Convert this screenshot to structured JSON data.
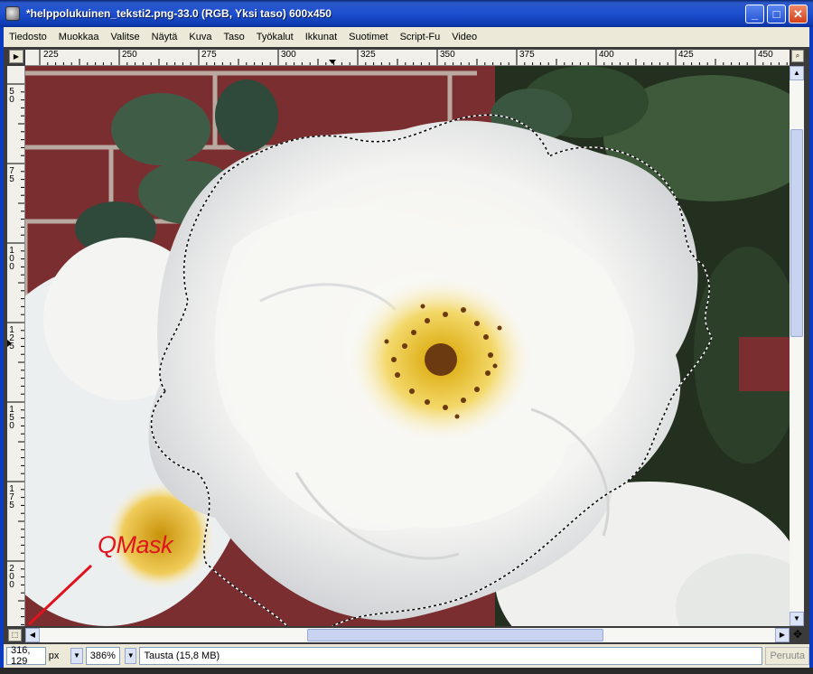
{
  "window": {
    "title": "*helppolukuinen_teksti2.png-33.0 (RGB, Yksi taso) 600x450",
    "minimize_glyph": "_",
    "maximize_glyph": "□",
    "close_glyph": "✕"
  },
  "menubar": {
    "items": [
      "Tiedosto",
      "Muokkaa",
      "Valitse",
      "Näytä",
      "Kuva",
      "Taso",
      "Työkalut",
      "Ikkunat",
      "Suotimet",
      "Script-Fu",
      "Video"
    ]
  },
  "rulers": {
    "horizontal_labels": [
      "225",
      "250",
      "275",
      "300",
      "325",
      "350",
      "375",
      "400",
      "425",
      "450"
    ],
    "vertical_labels": [
      "50",
      "75",
      "100",
      "125",
      "150",
      "175",
      "200"
    ]
  },
  "annotation": {
    "label": "QMask",
    "color": "#e0141e"
  },
  "statusbar": {
    "coordinates": "316, 129",
    "unit": "px",
    "zoom": "386%",
    "message": "Tausta (15,8 MB)",
    "cancel_label": "Peruuta"
  },
  "icons": {
    "app": "gimp-wilber-icon",
    "ruler_corner": "menu-arrow-icon",
    "navigate": "magnifier-icon",
    "quick_mask": "quick-mask-icon",
    "move": "move-cross-icon"
  }
}
